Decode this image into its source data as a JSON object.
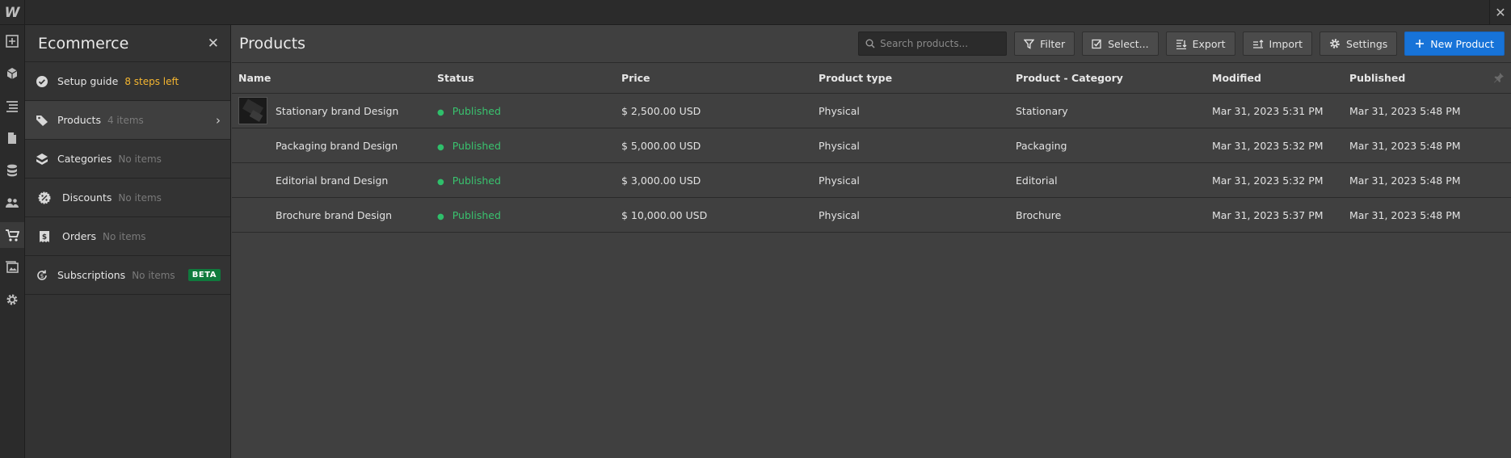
{
  "app": {
    "logo_text": "W",
    "close_glyph": "✕"
  },
  "rail": {
    "icons": [
      "add-icon",
      "box-icon",
      "navigator-icon",
      "pages-icon",
      "cms-icon",
      "users-icon",
      "ecommerce-cart-icon",
      "assets-icon",
      "settings-gear-icon"
    ],
    "active": "ecommerce-cart-icon"
  },
  "panel": {
    "title": "Ecommerce",
    "items": [
      {
        "label": "Setup guide",
        "meta": "8 steps left"
      },
      {
        "label": "Products",
        "meta": "4 items"
      },
      {
        "label": "Categories",
        "meta": "No items"
      },
      {
        "label": "Discounts",
        "meta": "No items"
      },
      {
        "label": "Orders",
        "meta": "No items"
      },
      {
        "label": "Subscriptions",
        "meta": "No items",
        "badge": "BETA"
      }
    ]
  },
  "main": {
    "title": "Products",
    "search_placeholder": "Search products...",
    "buttons": {
      "filter": "Filter",
      "select": "Select...",
      "export": "Export",
      "import": "Import",
      "settings": "Settings",
      "new_product": "New Product"
    },
    "columns": [
      "Name",
      "Status",
      "Price",
      "Product type",
      "Product - Category",
      "Modified",
      "Published"
    ],
    "rows": [
      {
        "name": "Stationary brand Design",
        "status": "Published",
        "price": "$ 2,500.00 USD",
        "type": "Physical",
        "category": "Stationary",
        "modified": "Mar 31, 2023 5:31 PM",
        "published": "Mar 31, 2023 5:48 PM"
      },
      {
        "name": "Packaging brand Design",
        "status": "Published",
        "price": "$ 5,000.00 USD",
        "type": "Physical",
        "category": "Packaging",
        "modified": "Mar 31, 2023 5:32 PM",
        "published": "Mar 31, 2023 5:48 PM"
      },
      {
        "name": "Editorial brand Design",
        "status": "Published",
        "price": "$ 3,000.00 USD",
        "type": "Physical",
        "category": "Editorial",
        "modified": "Mar 31, 2023 5:32 PM",
        "published": "Mar 31, 2023 5:48 PM"
      },
      {
        "name": "Brochure brand Design",
        "status": "Published",
        "price": "$ 10,000.00 USD",
        "type": "Physical",
        "category": "Brochure",
        "modified": "Mar 31, 2023 5:37 PM",
        "published": "Mar 31, 2023 5:48 PM"
      }
    ]
  },
  "colors": {
    "accent": "#1773d8",
    "published": "#39c26e",
    "warning": "#f5b630",
    "beta": "#0f7a3d"
  }
}
